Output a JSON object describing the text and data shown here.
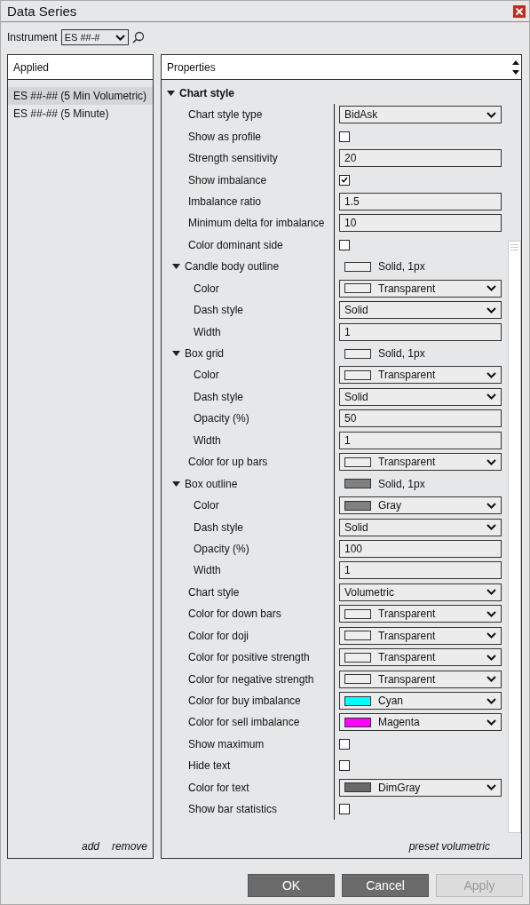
{
  "window": {
    "title": "Data Series"
  },
  "instrument": {
    "label": "Instrument",
    "value": "ES ##-#"
  },
  "applied": {
    "header": "Applied",
    "items": [
      {
        "label": "ES ##-## (5 Min Volumetric)",
        "selected": true
      },
      {
        "label": "ES ##-## (5 Minute)",
        "selected": false
      }
    ],
    "links": [
      "add",
      "remove"
    ]
  },
  "properties": {
    "header": "Properties",
    "section": {
      "label": "Chart style",
      "expanded": true,
      "rows": [
        {
          "kind": "select",
          "label": "Chart style type",
          "value": "BidAsk"
        },
        {
          "kind": "checkbox",
          "label": "Show as profile",
          "checked": false
        },
        {
          "kind": "text",
          "label": "Strength sensitivity",
          "value": "20"
        },
        {
          "kind": "checkbox",
          "label": "Show imbalance",
          "checked": true
        },
        {
          "kind": "text",
          "label": "Imbalance ratio",
          "value": "1.5"
        },
        {
          "kind": "text",
          "label": "Minimum delta for imbalance",
          "value": "10"
        },
        {
          "kind": "checkbox",
          "label": "Color dominant side",
          "checked": false
        },
        {
          "kind": "stroke",
          "label": "Candle body outline",
          "expanded": true,
          "color": "#eeeeee",
          "value": "Solid, 1px",
          "children": [
            {
              "kind": "color",
              "label": "Color",
              "value": "Transparent",
              "color": "#eeeeee"
            },
            {
              "kind": "select",
              "label": "Dash style",
              "value": "Solid"
            },
            {
              "kind": "text",
              "label": "Width",
              "value": "1"
            }
          ]
        },
        {
          "kind": "stroke",
          "label": "Box grid",
          "expanded": true,
          "color": "#eeeeee",
          "value": "Solid, 1px",
          "children": [
            {
              "kind": "color",
              "label": "Color",
              "value": "Transparent",
              "color": "#eeeeee"
            },
            {
              "kind": "select",
              "label": "Dash style",
              "value": "Solid"
            },
            {
              "kind": "text",
              "label": "Opacity (%)",
              "value": "50"
            },
            {
              "kind": "text",
              "label": "Width",
              "value": "1"
            }
          ]
        },
        {
          "kind": "color",
          "label": "Color for up bars",
          "value": "Transparent",
          "color": "#eeeeee"
        },
        {
          "kind": "stroke",
          "label": "Box outline",
          "expanded": true,
          "color": "#808080",
          "value": "Solid, 1px",
          "children": [
            {
              "kind": "color",
              "label": "Color",
              "value": "Gray",
              "color": "#808080"
            },
            {
              "kind": "select",
              "label": "Dash style",
              "value": "Solid"
            },
            {
              "kind": "text",
              "label": "Opacity (%)",
              "value": "100"
            },
            {
              "kind": "text",
              "label": "Width",
              "value": "1"
            }
          ]
        },
        {
          "kind": "select",
          "label": "Chart style",
          "value": "Volumetric"
        },
        {
          "kind": "color",
          "label": "Color for down bars",
          "value": "Transparent",
          "color": "#eeeeee"
        },
        {
          "kind": "color",
          "label": "Color for doji",
          "value": "Transparent",
          "color": "#eeeeee"
        },
        {
          "kind": "color",
          "label": "Color for positive strength",
          "value": "Transparent",
          "color": "#eeeeee"
        },
        {
          "kind": "color",
          "label": "Color for negative strength",
          "value": "Transparent",
          "color": "#eeeeee"
        },
        {
          "kind": "color",
          "label": "Color for buy imbalance",
          "value": "Cyan",
          "color": "#00ffff"
        },
        {
          "kind": "color",
          "label": "Color for sell imbalance",
          "value": "Magenta",
          "color": "#ff00ff"
        },
        {
          "kind": "checkbox",
          "label": "Show maximum",
          "checked": false
        },
        {
          "kind": "checkbox",
          "label": "Hide text",
          "checked": false
        },
        {
          "kind": "color",
          "label": "Color for text",
          "value": "DimGray",
          "color": "#696969"
        },
        {
          "kind": "checkbox",
          "label": "Show bar statistics",
          "checked": false
        }
      ]
    },
    "footer_link": "preset volumetric"
  },
  "buttons": [
    {
      "label": "OK",
      "disabled": false
    },
    {
      "label": "Cancel",
      "disabled": false
    },
    {
      "label": "Apply",
      "disabled": true
    }
  ]
}
